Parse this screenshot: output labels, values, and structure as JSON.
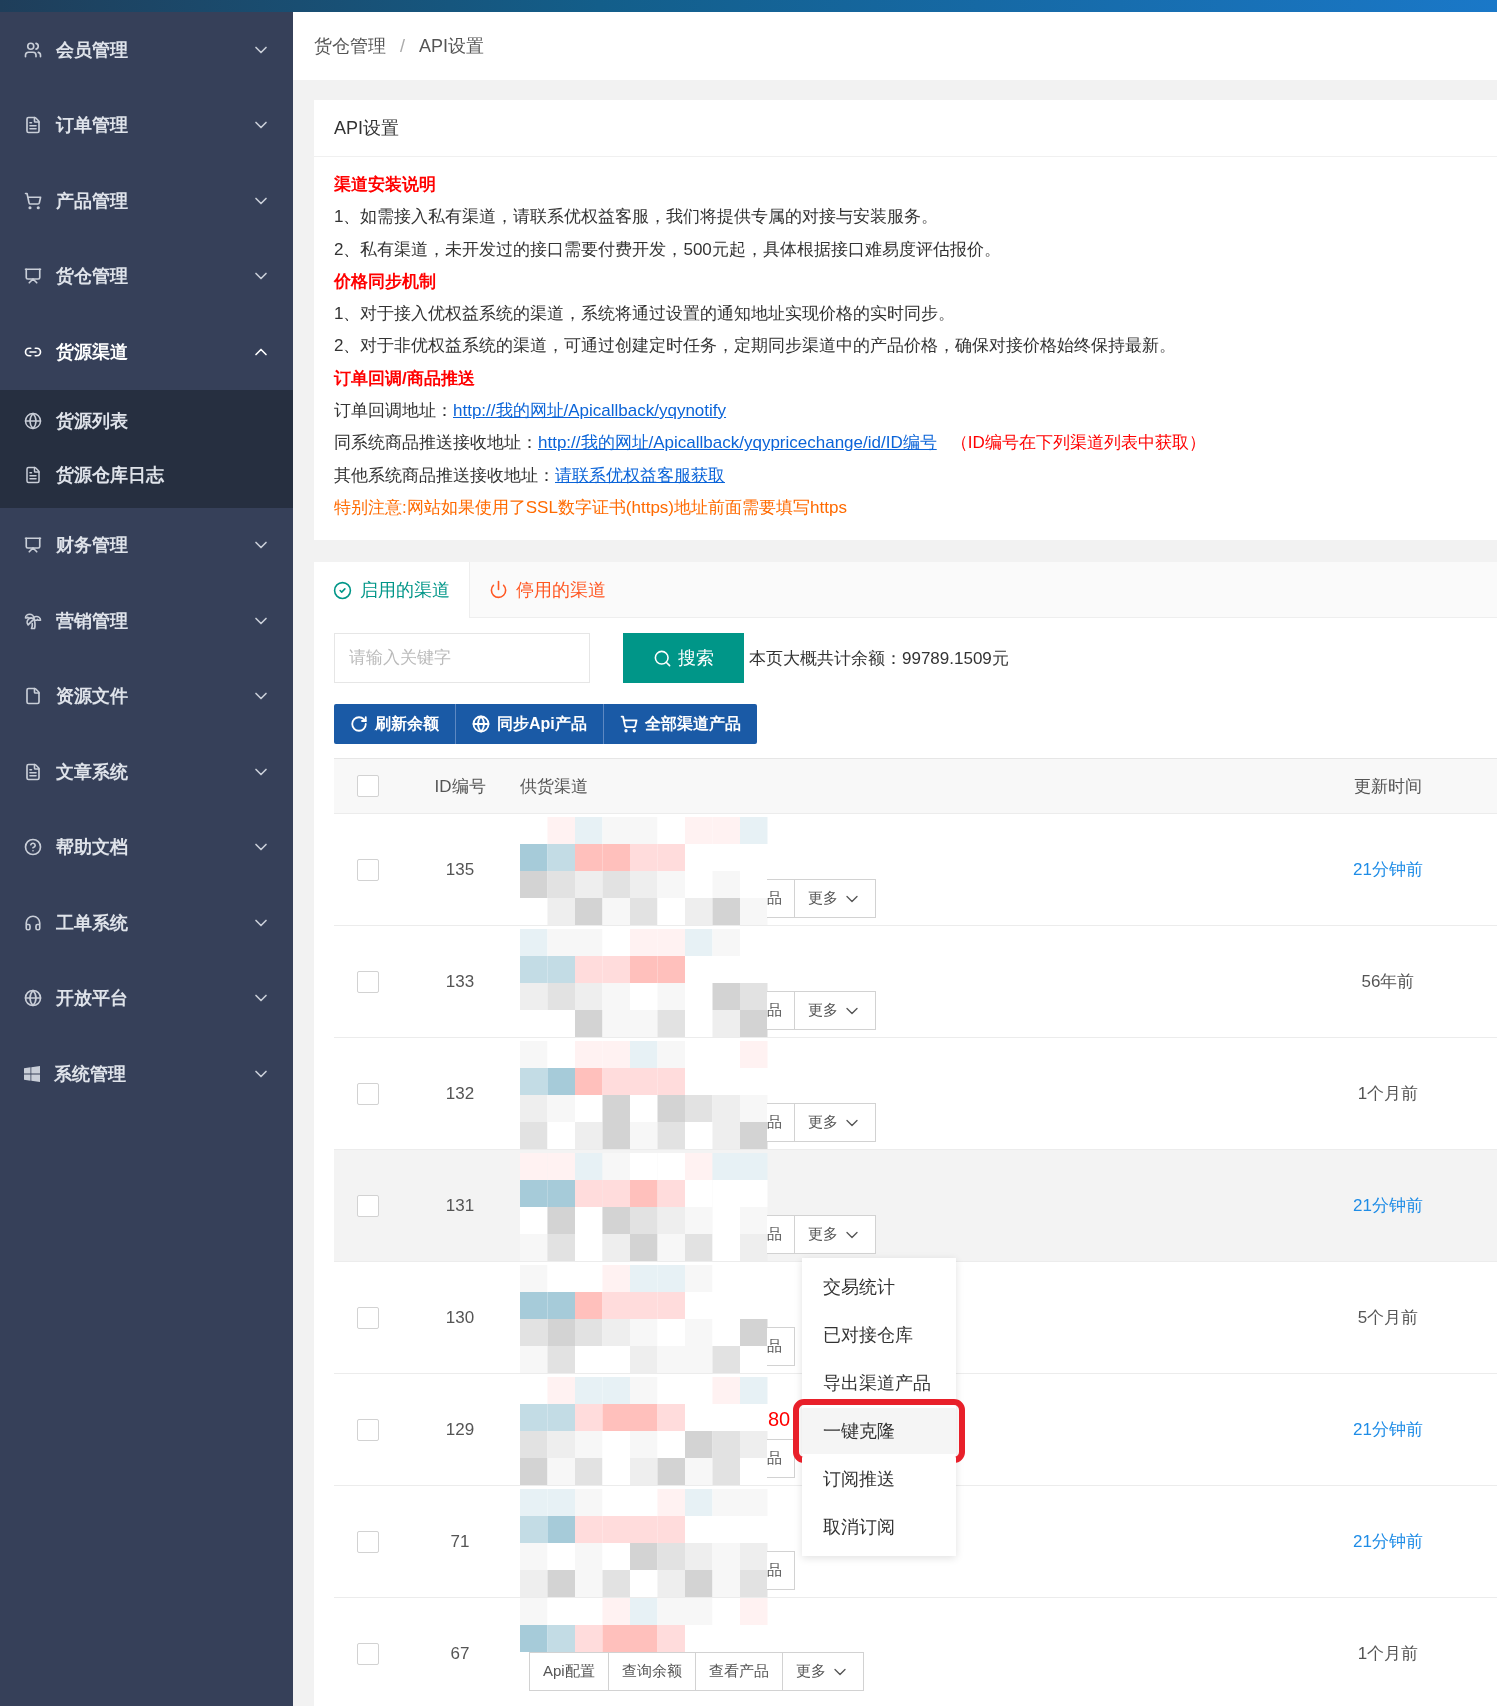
{
  "sidebar": {
    "items": [
      {
        "label": "会员管理",
        "expanded": false
      },
      {
        "label": "订单管理",
        "expanded": false
      },
      {
        "label": "产品管理",
        "expanded": false
      },
      {
        "label": "货仓管理",
        "expanded": false
      },
      {
        "label": "货源渠道",
        "expanded": true,
        "children": [
          {
            "label": "货源列表"
          },
          {
            "label": "货源仓库日志"
          }
        ]
      },
      {
        "label": "财务管理",
        "expanded": false
      },
      {
        "label": "营销管理",
        "expanded": false
      },
      {
        "label": "资源文件",
        "expanded": false
      },
      {
        "label": "文章系统",
        "expanded": false
      },
      {
        "label": "帮助文档",
        "expanded": false
      },
      {
        "label": "工单系统",
        "expanded": false
      },
      {
        "label": "开放平台",
        "expanded": false
      },
      {
        "label": "系统管理",
        "expanded": false
      }
    ]
  },
  "breadcrumb": {
    "items": [
      "货仓管理",
      "API设置"
    ],
    "separator": "/"
  },
  "notice_card": {
    "title": "API设置",
    "lines": [
      {
        "kind": "heading",
        "text": "渠道安装说明"
      },
      {
        "kind": "text",
        "text": "1、如需接入私有渠道，请联系优权益客服，我们将提供专属的对接与安装服务。"
      },
      {
        "kind": "text",
        "text": "2、私有渠道，未开发过的接口需要付费开发，500元起，具体根据接口难易度评估报价。"
      },
      {
        "kind": "heading",
        "text": "价格同步机制"
      },
      {
        "kind": "text",
        "text": "1、对于接入优权益系统的渠道，系统将通过设置的通知地址实现价格的实时同步。"
      },
      {
        "kind": "text",
        "text": "2、对于非优权益系统的渠道，可通过创建定时任务，定期同步渠道中的产品价格，确保对接价格始终保持最新。"
      },
      {
        "kind": "heading",
        "text": "订单回调/商品推送"
      },
      {
        "kind": "link",
        "label": "订单回调地址：",
        "link": "http://我的网址/Apicallback/yqynotify"
      },
      {
        "kind": "link",
        "label": "同系统商品推送接收地址：",
        "link": "http://我的网址/Apicallback/yqypricechange/id/ID编号",
        "note": "（ID编号在下列渠道列表中获取）"
      },
      {
        "kind": "link",
        "label": "其他系统商品推送接收地址：",
        "link": "请联系优权益客服获取"
      },
      {
        "kind": "warning",
        "text": "特别注意:网站如果使用了SSL数字证书(https)地址前面需要填写https"
      }
    ]
  },
  "channel_panel": {
    "tabs": [
      {
        "label": "启用的渠道",
        "selected": true,
        "color": "#009688"
      },
      {
        "label": "停用的渠道",
        "selected": false,
        "color": "#ff5722"
      }
    ],
    "search": {
      "placeholder": "请输入关键字"
    },
    "search_button": "搜索",
    "total": "本页大概共计余额：99789.1509元",
    "actions": [
      "刷新余额",
      "同步Api产品",
      "全部渠道产品"
    ],
    "table": {
      "columns": [
        "ID编号",
        "供货渠道",
        "更新时间"
      ],
      "header_checked": false,
      "rows": [
        {
          "id": "135",
          "checked": false,
          "highlighted": false,
          "kind": "covered",
          "buttons": [
            "品",
            "更多"
          ],
          "time": "21分钟前",
          "recent": true
        },
        {
          "id": "133",
          "checked": false,
          "highlighted": false,
          "kind": "covered",
          "buttons": [
            "品",
            "更多"
          ],
          "time": "56年前",
          "recent": false
        },
        {
          "id": "132",
          "checked": false,
          "highlighted": false,
          "kind": "covered",
          "buttons": [
            "品",
            "更多"
          ],
          "time": "1个月前",
          "recent": false
        },
        {
          "id": "131",
          "checked": false,
          "highlighted": true,
          "kind": "covered",
          "buttons": [
            "品",
            "更多"
          ],
          "time": "21分钟前",
          "recent": true
        },
        {
          "id": "130",
          "checked": false,
          "highlighted": false,
          "kind": "covered",
          "buttons": [
            "品"
          ],
          "time": "5个月前",
          "recent": false
        },
        {
          "id": "129",
          "checked": false,
          "highlighted": false,
          "kind": "covered",
          "note": "80",
          "buttons": [
            "品"
          ],
          "time": "21分钟前",
          "recent": true
        },
        {
          "id": "71",
          "checked": false,
          "highlighted": false,
          "kind": "covered",
          "buttons": [
            "品"
          ],
          "time": "21分钟前",
          "recent": true
        },
        {
          "id": "67",
          "checked": false,
          "highlighted": false,
          "kind": "full",
          "buttons": [
            "Api配置",
            "查询余额",
            "查看产品",
            "更多"
          ],
          "time": "1个月前",
          "recent": false
        }
      ]
    },
    "dropdown": {
      "items": [
        {
          "label": "交易统计",
          "selected": false
        },
        {
          "label": "已对接仓库",
          "selected": false
        },
        {
          "label": "导出渠道产品",
          "selected": false
        },
        {
          "label": "一键克隆",
          "selected": true
        },
        {
          "label": "订阅推送",
          "selected": false
        },
        {
          "label": "取消订阅",
          "selected": false
        }
      ]
    }
  }
}
